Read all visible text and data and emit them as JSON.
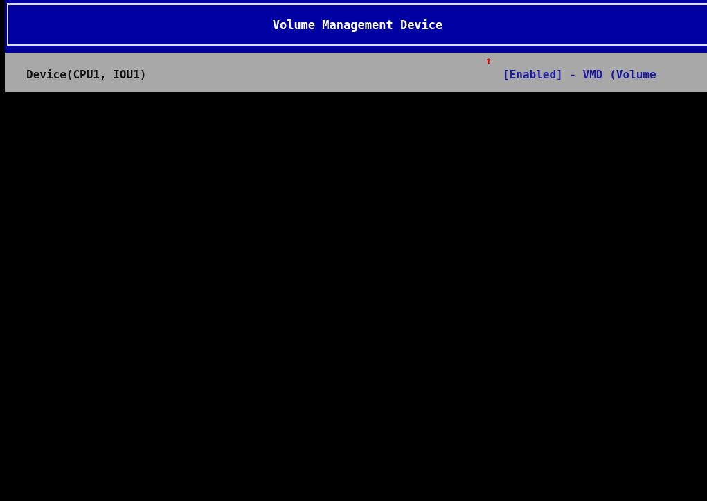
{
  "header": {
    "title": "Volume Management Device"
  },
  "scroll_indicator": "↑",
  "setting": {
    "label": "Device(CPU1, IOU1)",
    "value": "[Enabled] - VMD (Volume"
  }
}
